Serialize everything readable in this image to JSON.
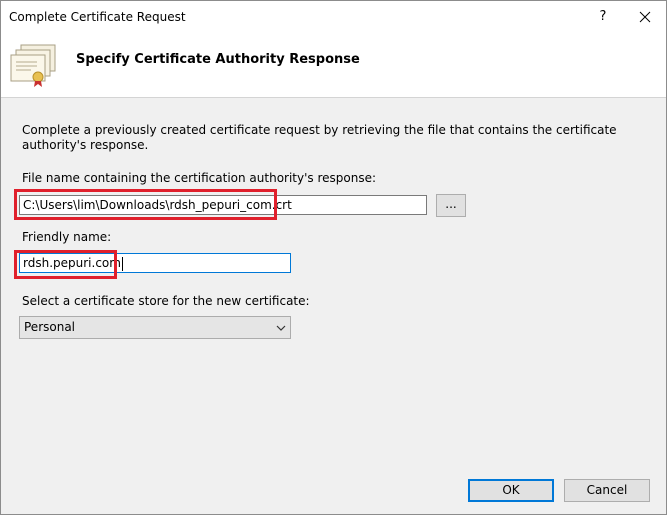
{
  "window": {
    "title": "Complete Certificate Request",
    "help_label": "?"
  },
  "header": {
    "title": "Specify Certificate Authority Response",
    "icon": "certificate-icon"
  },
  "content": {
    "description": "Complete a previously created certificate request by retrieving the file that contains the certificate authority's response.",
    "file_label": "File name containing the certification authority's response:",
    "file_value": "C:\\Users\\lim\\Downloads\\rdsh_pepuri_com.crt",
    "browse_label": "...",
    "friendly_label": "Friendly name:",
    "friendly_value": "rdsh.pepuri.com",
    "store_label": "Select a certificate store for the new certificate:",
    "store_selected": "Personal"
  },
  "buttons": {
    "ok": "OK",
    "cancel": "Cancel"
  },
  "colors": {
    "highlight": "#e0202c",
    "focus": "#0078d7"
  }
}
